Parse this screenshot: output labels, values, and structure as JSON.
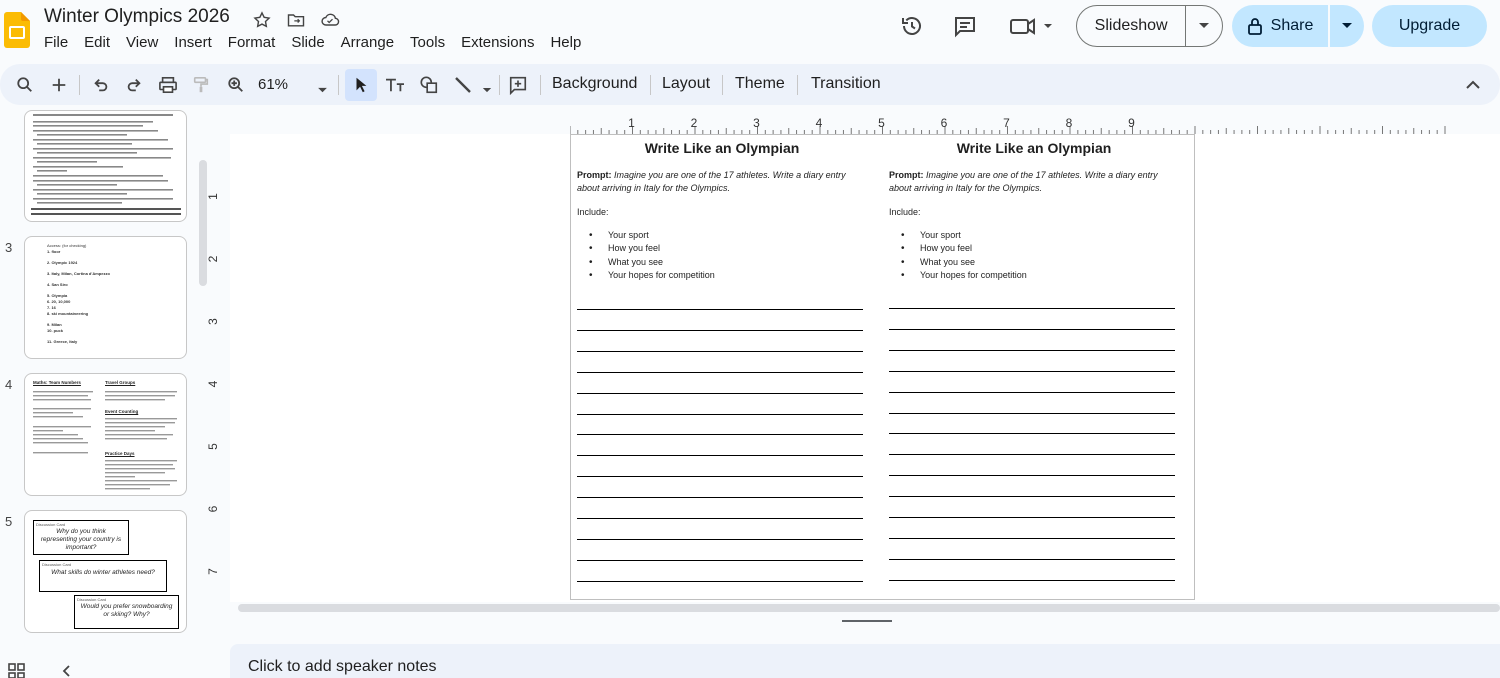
{
  "app": {
    "doc_title": "Winter Olympics 2026",
    "menu": [
      "File",
      "Edit",
      "View",
      "Insert",
      "Format",
      "Slide",
      "Arrange",
      "Tools",
      "Extensions",
      "Help"
    ],
    "slideshow_label": "Slideshow",
    "share_label": "Share",
    "upgrade_label": "Upgrade",
    "brand_color": "#fbbc04",
    "accent_color": "#c2e7ff"
  },
  "toolbar": {
    "zoom": "61%",
    "background_label": "Background",
    "layout_label": "Layout",
    "theme_label": "Theme",
    "transition_label": "Transition"
  },
  "ruler": {
    "h_ticks": [
      "1",
      "2",
      "3",
      "4",
      "5",
      "6",
      "7",
      "8",
      "9"
    ],
    "v_ticks": [
      "1",
      "2",
      "3",
      "4",
      "5",
      "6",
      "7"
    ]
  },
  "filmstrip": {
    "slides": [
      {
        "num": "",
        "kind": "quiz"
      },
      {
        "num": "3",
        "kind": "answers"
      },
      {
        "num": "4",
        "kind": "math",
        "col1_title": "Maths: Team Numbers",
        "col2_title": "Travel Groups",
        "col2_title2": "Event Counting",
        "col2_title3": "Practice Days"
      },
      {
        "num": "5",
        "kind": "cards",
        "card_label": "Discussion Card",
        "cards": [
          "Why do you think representing your country is important?",
          "What skills do winter athletes need?",
          "Would you prefer snowboarding or skiing? Why?"
        ]
      }
    ],
    "answers": [
      "Access: (for checking)",
      "1. floor",
      "2. Olympic 1924",
      "3. Italy, Milan, Cortina d'Ampezzo",
      "4. San Siro",
      "5. Olympia",
      "6. 20, 10,000",
      "7. 16",
      "8. ski mountaineering",
      "9. Milan",
      "10. puck",
      "11. Greece, Italy"
    ]
  },
  "slide": {
    "columns": [
      {
        "title": "Write Like an Olympian",
        "prompt_label": "Prompt:",
        "prompt_text": " Imagine you are one of the 17 athletes. Write a diary entry about arriving in Italy for the Olympics.",
        "include_label": "Include:",
        "bullets": [
          "Your sport",
          "How you feel",
          "What you see",
          "Your hopes for competition"
        ]
      },
      {
        "title": "Write Like an Olympian",
        "prompt_label": "Prompt:",
        "prompt_text": " Imagine you are one of the 17 athletes. Write a diary entry about arriving in Italy for the Olympics.",
        "include_label": "Include:",
        "bullets": [
          "Your sport",
          "How you feel",
          "What you see",
          "Your hopes for competition"
        ]
      }
    ]
  },
  "notes": {
    "placeholder": "Click to add speaker notes"
  }
}
